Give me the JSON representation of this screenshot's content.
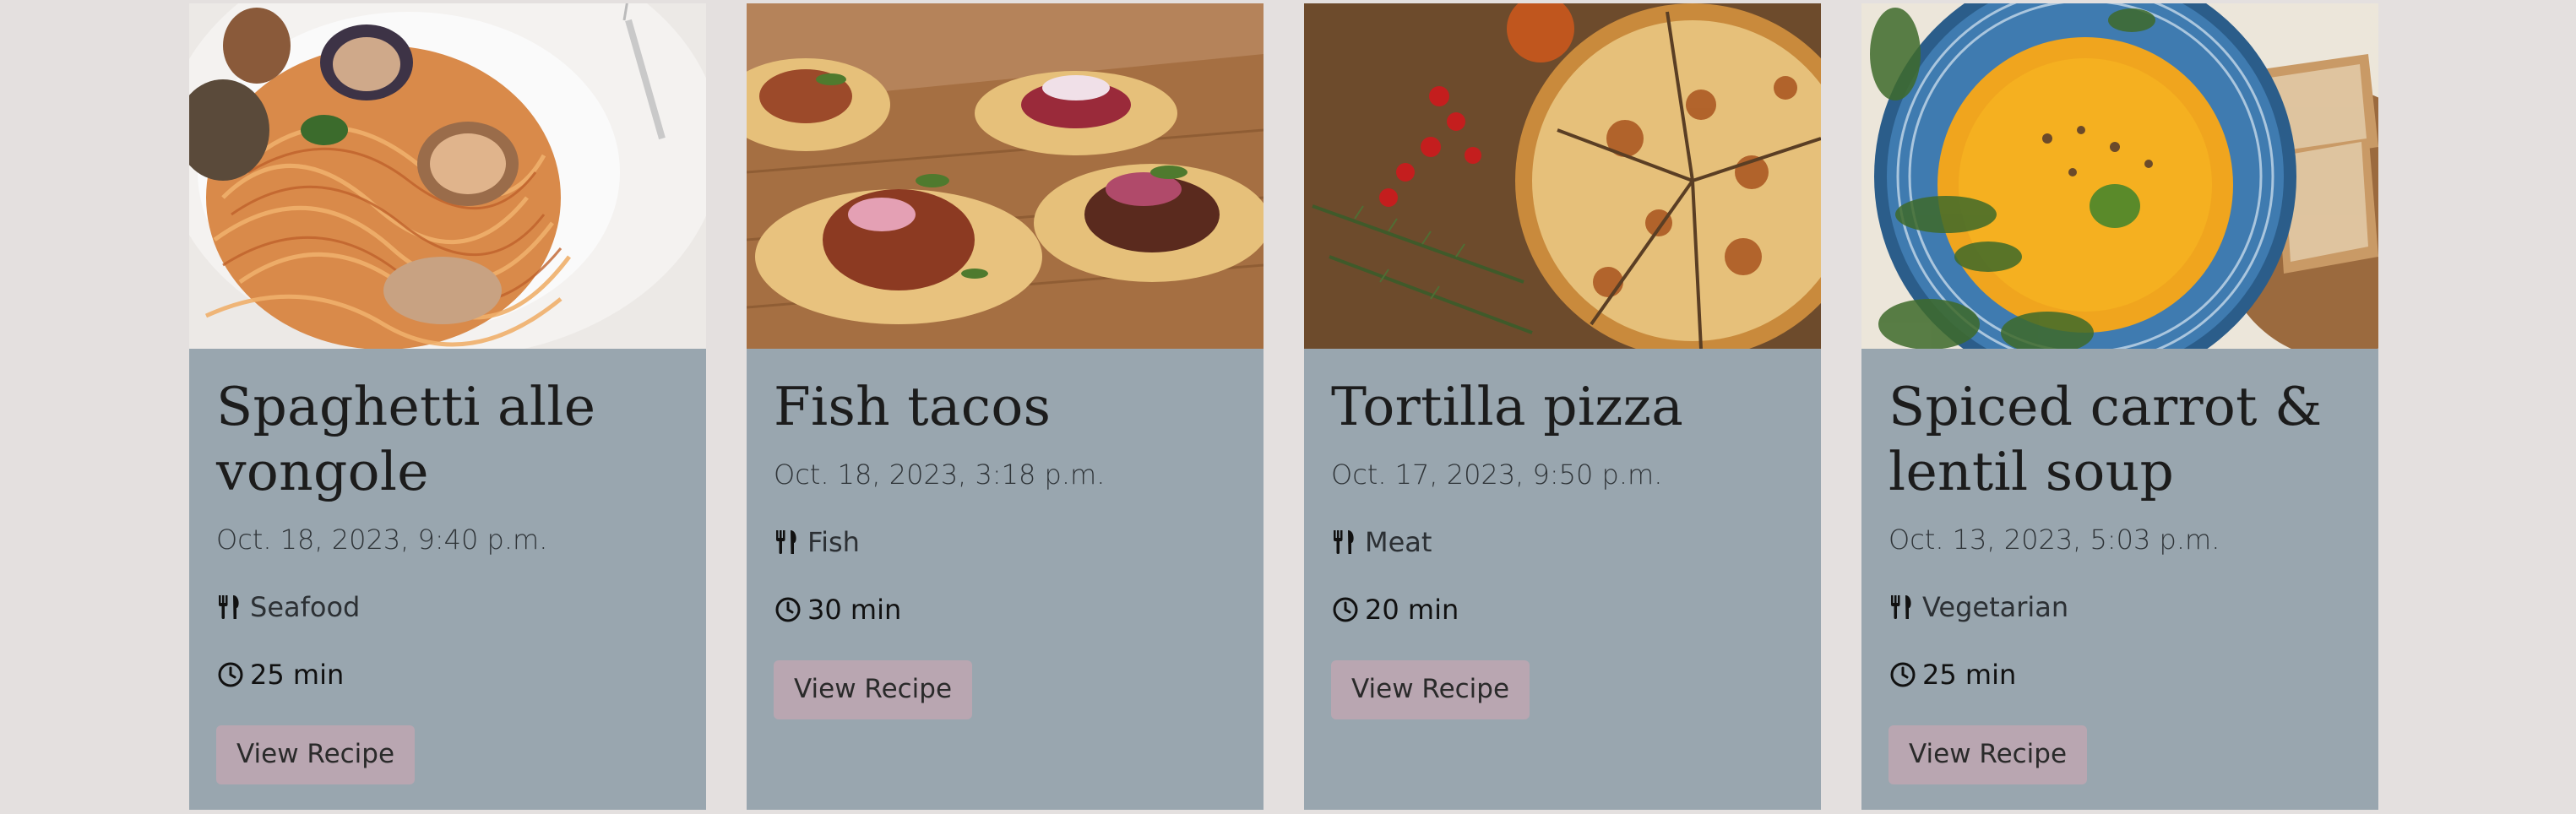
{
  "recipes": [
    {
      "title": "Spaghetti alle vongole",
      "date": "Oct. 18, 2023, 9:40 p.m.",
      "category": "Seafood",
      "category_icon": "utensils-icon",
      "time": "25 min",
      "time_icon": "clock-icon",
      "button_label": "View Recipe",
      "image_subject": "spaghetti with clams"
    },
    {
      "title": "Fish tacos",
      "date": "Oct. 18, 2023, 3:18 p.m.",
      "category": "Fish",
      "category_icon": "utensils-icon",
      "time": "30 min",
      "time_icon": "clock-icon",
      "button_label": "View Recipe",
      "image_subject": "tacos on wooden board"
    },
    {
      "title": "Tortilla pizza",
      "date": "Oct. 17, 2023, 9:50 p.m.",
      "category": "Meat",
      "category_icon": "utensils-icon",
      "time": "20 min",
      "time_icon": "clock-icon",
      "button_label": "View Recipe",
      "image_subject": "sliced pizza with tomatoes and rosemary"
    },
    {
      "title": "Spiced carrot & lentil soup",
      "date": "Oct. 13, 2023, 5:03 p.m.",
      "category": "Vegetarian",
      "category_icon": "utensils-icon",
      "time": "25 min",
      "time_icon": "clock-icon",
      "button_label": "View Recipe",
      "image_subject": "orange soup in blue bowl with bread"
    }
  ],
  "colors": {
    "page_background": "#e4e0df",
    "card_background": "#99a6af",
    "button_background": "#b9a6b1"
  }
}
